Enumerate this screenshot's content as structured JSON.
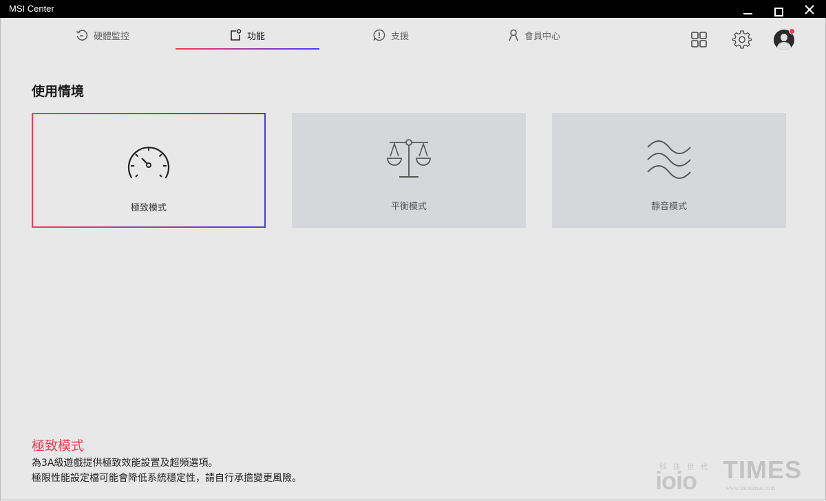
{
  "window": {
    "title": "MSI Center"
  },
  "nav": {
    "tabs": [
      {
        "label": "硬體監控",
        "icon": "hardware-monitor-icon",
        "active": false
      },
      {
        "label": "功能",
        "icon": "features-icon",
        "active": true
      },
      {
        "label": "支援",
        "icon": "support-icon",
        "active": false
      },
      {
        "label": "會員中心",
        "icon": "member-icon",
        "active": false
      }
    ],
    "right_icons": [
      "grid-icon",
      "gear-icon",
      "avatar"
    ]
  },
  "main": {
    "section_title": "使用情境",
    "cards": [
      {
        "label": "極致模式",
        "icon": "speedometer-icon",
        "selected": true
      },
      {
        "label": "平衡模式",
        "icon": "balance-scale-icon",
        "selected": false
      },
      {
        "label": "靜音模式",
        "icon": "waves-icon",
        "selected": false
      }
    ]
  },
  "description": {
    "title": "極致模式",
    "line1": "為3A級遊戲提供極致效能設置及超頻選項。",
    "line2": "極限性能設定檔可能會降低系統穩定性，請自行承擔變更風險。"
  },
  "watermark": {
    "small": "科技世代",
    "logo": "ioio",
    "brand": "TIMES",
    "url": "www.ioiotimes.com"
  },
  "colors": {
    "accent_red": "#ef3d55",
    "accent_blue": "#4a3df0",
    "background": "#e8e8e8",
    "card_inactive": "#d6d7db"
  }
}
